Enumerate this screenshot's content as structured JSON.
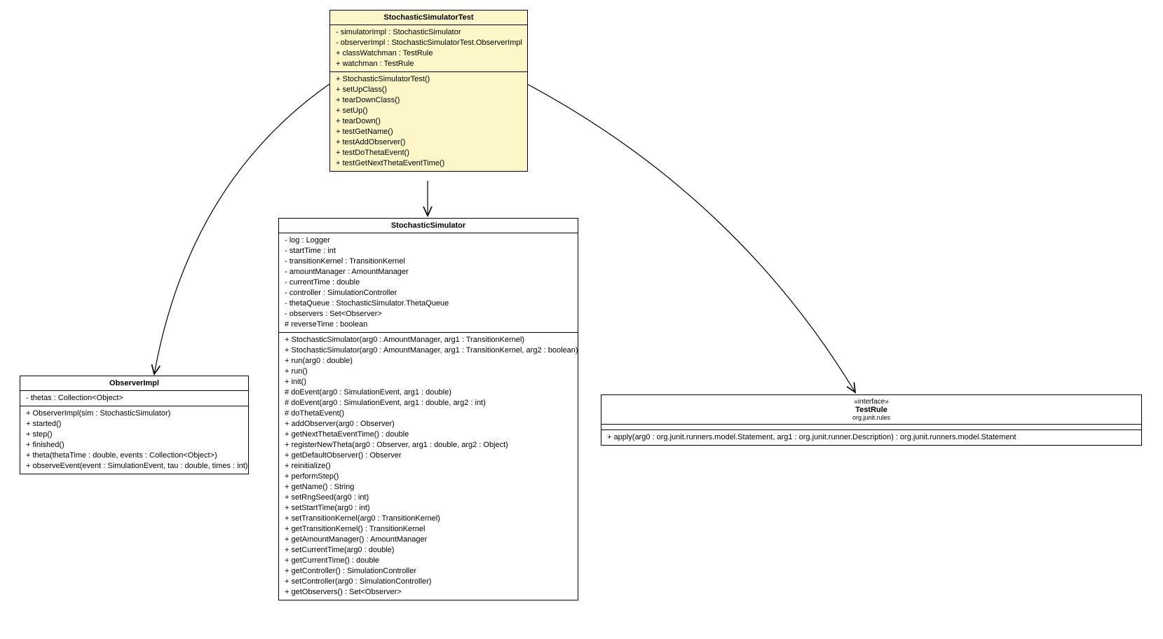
{
  "classes": {
    "test": {
      "name": "StochasticSimulatorTest",
      "attrs": [
        "- simulatorImpl : StochasticSimulator",
        "- observerImpl : StochasticSimulatorTest.ObserverImpl",
        "+ classWatchman : TestRule",
        "+ watchman : TestRule"
      ],
      "ops": [
        "+ StochasticSimulatorTest()",
        "+ setUpClass()",
        "+ tearDownClass()",
        "+ setUp()",
        "+ tearDown()",
        "+ testGetName()",
        "+ testAddObserver()",
        "+ testDoThetaEvent()",
        "+ testGetNextThetaEventTime()"
      ]
    },
    "observer": {
      "name": "ObserverImpl",
      "attrs": [
        "- thetas : Collection<Object>"
      ],
      "ops": [
        "+ ObserverImpl(sim : StochasticSimulator)",
        "+ started()",
        "+ step()",
        "+ finished()",
        "+ theta(thetaTime : double, events : Collection<Object>)",
        "+ observeEvent(event : SimulationEvent, tau : double, times : int)"
      ]
    },
    "sim": {
      "name": "StochasticSimulator",
      "attrs": [
        "- log : Logger",
        "- startTime : int",
        "- transitionKernel : TransitionKernel",
        "- amountManager : AmountManager",
        "- currentTime : double",
        "- controller : SimulationController",
        "- thetaQueue : StochasticSimulator.ThetaQueue",
        "- observers : Set<Observer>",
        "# reverseTime : boolean"
      ],
      "ops": [
        "+ StochasticSimulator(arg0 : AmountManager, arg1 : TransitionKernel)",
        "+ StochasticSimulator(arg0 : AmountManager, arg1 : TransitionKernel, arg2 : boolean)",
        "+ run(arg0 : double)",
        "+ run()",
        "+ init()",
        "# doEvent(arg0 : SimulationEvent, arg1 : double)",
        "# doEvent(arg0 : SimulationEvent, arg1 : double, arg2 : int)",
        "# doThetaEvent()",
        "+ addObserver(arg0 : Observer)",
        "+ getNextThetaEventTime() : double",
        "+ registerNewTheta(arg0 : Observer, arg1 : double, arg2 : Object)",
        "+ getDefaultObserver() : Observer",
        "+ reinitialize()",
        "+ performStep()",
        "+ getName() : String",
        "+ setRngSeed(arg0 : int)",
        "+ setStartTime(arg0 : int)",
        "+ setTransitionKernel(arg0 : TransitionKernel)",
        "+ getTransitionKernel() : TransitionKernel",
        "+ getAmountManager() : AmountManager",
        "+ setCurrentTime(arg0 : double)",
        "+ getCurrentTime() : double",
        "+ getController() : SimulationController",
        "+ setController(arg0 : SimulationController)",
        "+ getObservers() : Set<Observer>"
      ]
    },
    "rule": {
      "stereotype": "«interface»",
      "name": "TestRule",
      "pkg": "org.junit.rules",
      "attrs": [],
      "ops": [
        "+ apply(arg0 : org.junit.runners.model.Statement, arg1 : org.junit.runner.Description) : org.junit.runners.model.Statement"
      ]
    }
  }
}
